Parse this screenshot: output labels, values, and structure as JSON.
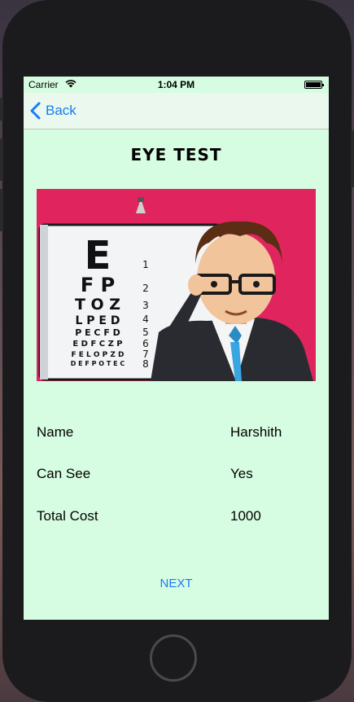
{
  "status": {
    "carrier": "Carrier",
    "time": "1:04 PM"
  },
  "nav": {
    "back_label": "Back"
  },
  "page": {
    "title": "EYE TEST"
  },
  "details": [
    {
      "label": "Name",
      "value": "Harshith"
    },
    {
      "label": "Can See",
      "value": "Yes"
    },
    {
      "label": "Total Cost",
      "value": "1000"
    }
  ],
  "actions": {
    "next_label": "NEXT"
  },
  "chart_rows": [
    "E",
    "F P",
    "T O Z",
    "L P E D",
    "P E C F D",
    "E D F C Z P",
    "F E L O P Z D",
    "D E F P O T E C"
  ],
  "chart_numbers": [
    "1",
    "2",
    "3",
    "4",
    "5",
    "6",
    "7",
    "8"
  ],
  "colors": {
    "accent": "#1a7cf5",
    "background": "#d6fde2",
    "hero_bg": "#e0245e"
  }
}
